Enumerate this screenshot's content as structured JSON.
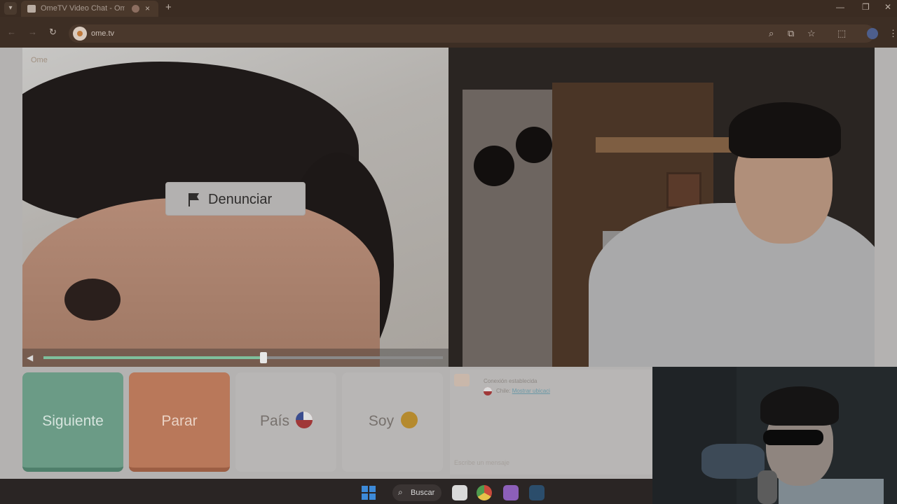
{
  "browser": {
    "tab_title": "OmeTV Video Chat - Ome",
    "tab_close": "×",
    "new_tab": "+",
    "url": "ome.tv",
    "window_controls": {
      "minimize": "—",
      "restore": "❐",
      "close": "✕"
    }
  },
  "page": {
    "brand": "Ome",
    "report_label": "Denunciar",
    "volume_level": 0.55
  },
  "controls": {
    "next_label": "Siguiente",
    "stop_label": "Parar",
    "country_label": "País",
    "gender_label": "Soy"
  },
  "chat": {
    "status": "Conexión establecida",
    "country_prefix": "Chile",
    "country_link": "Mostrar ubicaci",
    "input_placeholder": "Escribe un mensaje"
  },
  "taskbar": {
    "search_label": "Buscar"
  },
  "colors": {
    "next": "#6b9b86",
    "stop": "#b9785a",
    "volume_fill": "#7fbf9c"
  }
}
